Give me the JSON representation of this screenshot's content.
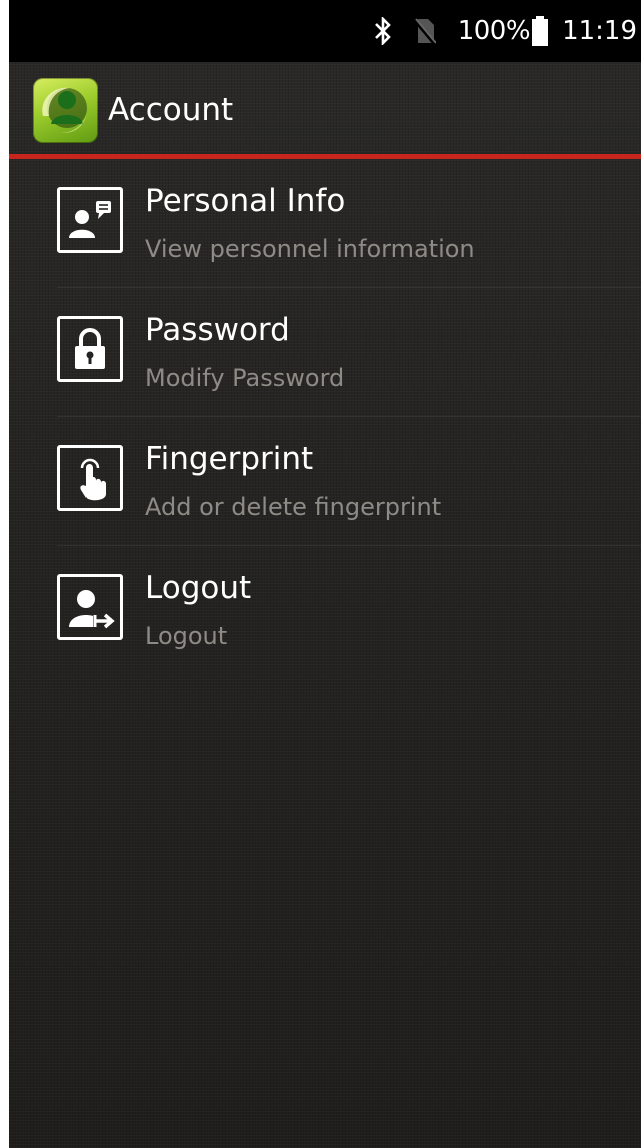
{
  "status_bar": {
    "battery": "100%",
    "time": "11:19"
  },
  "action_bar": {
    "title": "Account"
  },
  "menu": {
    "items": [
      {
        "title": "Personal Info",
        "subtitle": "View personnel information",
        "icon": "personal-info-icon"
      },
      {
        "title": "Password",
        "subtitle": "Modify Password",
        "icon": "lock-icon"
      },
      {
        "title": "Fingerprint",
        "subtitle": "Add or delete fingerprint",
        "icon": "fingerprint-touch-icon"
      },
      {
        "title": "Logout",
        "subtitle": "Logout",
        "icon": "logout-icon"
      }
    ]
  },
  "colors": {
    "accent_divider": "#c8261c",
    "subtitle_text": "#8e8b86",
    "background": "#242321"
  }
}
